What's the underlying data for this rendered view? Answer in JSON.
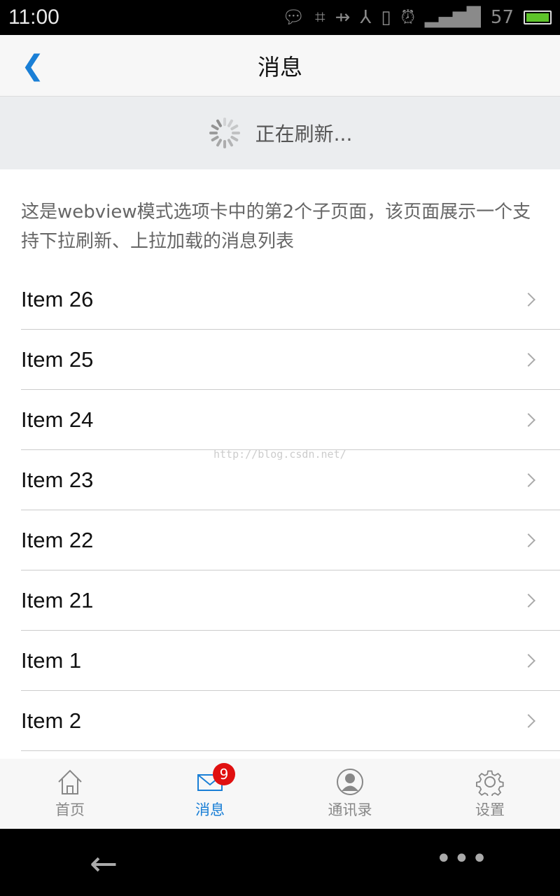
{
  "status_bar": {
    "time": "11:00",
    "battery": "57",
    "battery_color": "#5ec42a",
    "icons": [
      "chat-icon",
      "scan-icon",
      "usb-icon",
      "share-icon",
      "vibrate-icon",
      "alarm-icon",
      "signal-icon",
      "battery-icon"
    ]
  },
  "header": {
    "title": "消息",
    "accent": "#1a7fd6"
  },
  "refresh": {
    "text": "正在刷新..."
  },
  "description": "这是webview模式选项卡中的第2个子页面，该页面展示一个支持下拉刷新、上拉加载的消息列表",
  "items": [
    "Item 26",
    "Item 25",
    "Item 24",
    "Item 23",
    "Item 22",
    "Item 21",
    "Item 1",
    "Item 2"
  ],
  "watermark": "http://blog.csdn.net/",
  "tabs": [
    {
      "label": "首页",
      "icon": "home-icon"
    },
    {
      "label": "消息",
      "icon": "mail-icon",
      "badge": "9",
      "active": true
    },
    {
      "label": "通讯录",
      "icon": "contacts-icon"
    },
    {
      "label": "设置",
      "icon": "gear-icon"
    }
  ]
}
